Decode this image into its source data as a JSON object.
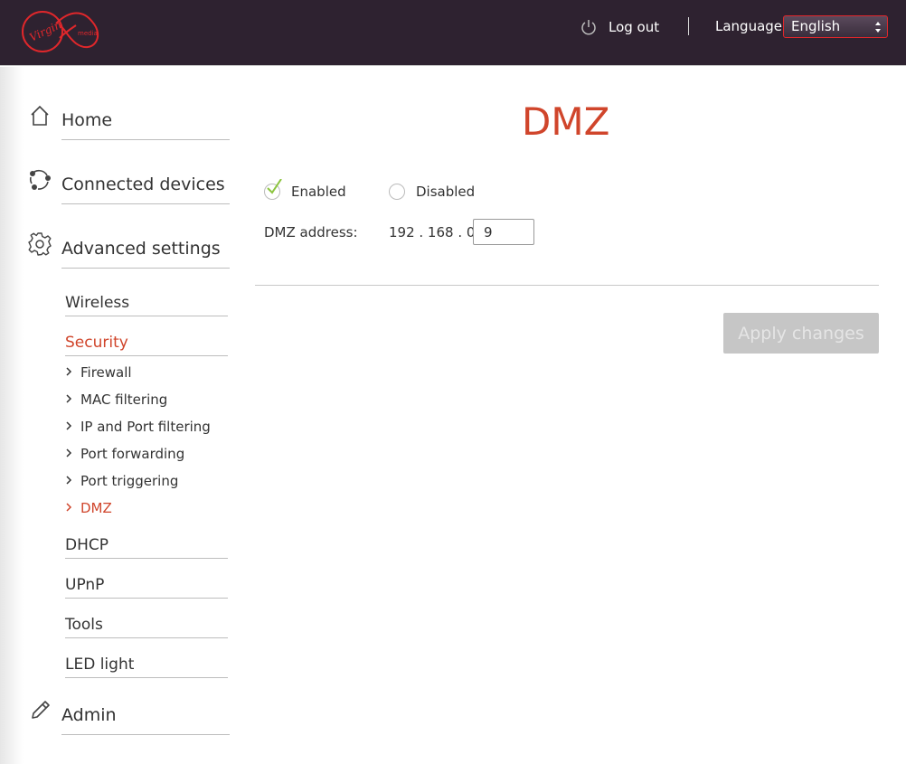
{
  "header": {
    "brand_logo_icon": "virgin-media-logo",
    "logout_label": "Log out",
    "language_label": "Language",
    "language_selected": "English"
  },
  "sidebar": {
    "main_items": [
      {
        "label": "Home",
        "icon": "home-icon"
      },
      {
        "label": "Connected devices",
        "icon": "devices-icon"
      },
      {
        "label": "Advanced settings",
        "icon": "gear-icon"
      },
      {
        "label": "Admin",
        "icon": "pencil-icon"
      }
    ],
    "advanced_sub_items": [
      {
        "label": "Wireless"
      },
      {
        "label": "Security",
        "active": true
      },
      {
        "label": "DHCP"
      },
      {
        "label": "UPnP"
      },
      {
        "label": "Tools"
      },
      {
        "label": "LED light"
      }
    ],
    "security_sub_items": [
      {
        "label": "Firewall"
      },
      {
        "label": "MAC filtering"
      },
      {
        "label": "IP and Port filtering"
      },
      {
        "label": "Port forwarding"
      },
      {
        "label": "Port triggering"
      },
      {
        "label": "DMZ",
        "active": true
      }
    ]
  },
  "main": {
    "title": "DMZ",
    "enabled_label": "Enabled",
    "disabled_label": "Disabled",
    "selected_mode": "Enabled",
    "dmz_address_label": "DMZ address:",
    "ip_prefix": "192 . 168 . 0 .",
    "ip_last_octet": "9",
    "apply_label": "Apply changes"
  },
  "colors": {
    "header_bg": "#2e2230",
    "accent": "#d0452b",
    "check_green": "#8cc43f",
    "disabled_button": "#c6c6c6"
  }
}
